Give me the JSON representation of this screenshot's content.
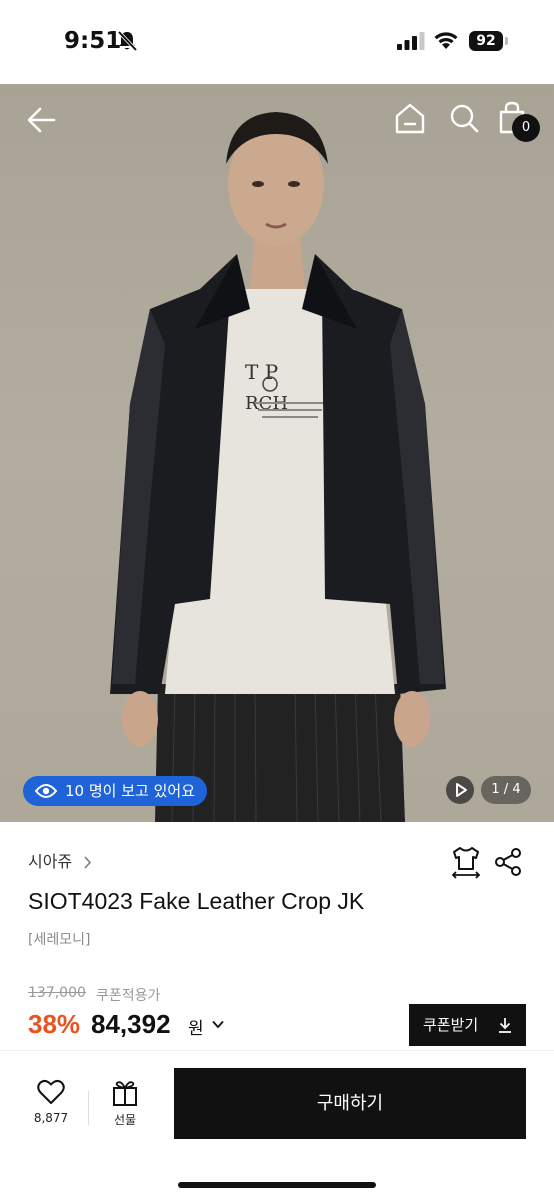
{
  "status_bar": {
    "time": "9:51",
    "battery": "92",
    "icons": [
      "bell-off-icon",
      "signal-icon",
      "wifi-icon",
      "battery-icon"
    ]
  },
  "hero": {
    "cart_count": "0",
    "viewers_text": "10 명이 보고 있어요",
    "page_indicator": "1 / 4",
    "colors": {
      "viewers_pill": "#1f63d8",
      "background": "#aea89a"
    }
  },
  "product": {
    "brand": "시아쥬",
    "title": "SIOT4023 Fake Leather Crop JK",
    "tag": "[세레모니]",
    "original_price": "137,000",
    "price_note": "쿠폰적용가",
    "discount": "38%",
    "final_price": "84,392",
    "currency": "원",
    "coupon_label": "쿠폰받기",
    "colors": {
      "discount": "#e8531f"
    }
  },
  "bottom_bar": {
    "like_count": "8,877",
    "gift_label": "선물",
    "buy_label": "구매하기"
  }
}
